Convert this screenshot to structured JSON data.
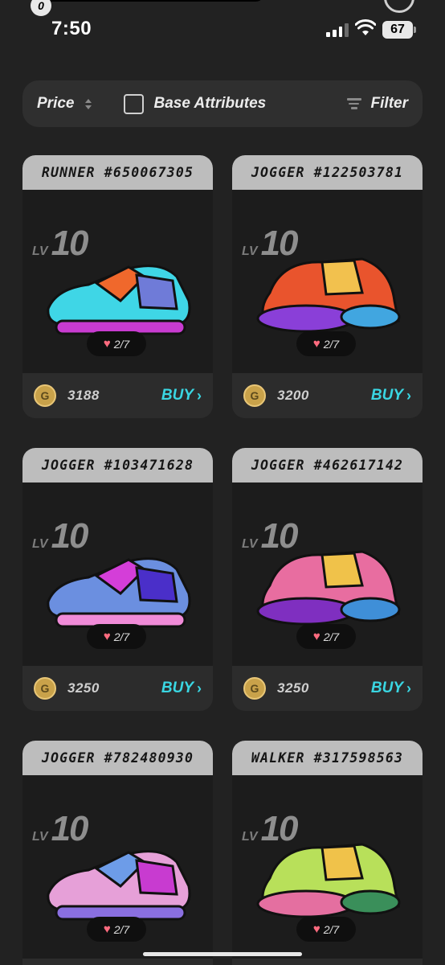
{
  "status": {
    "time": "7:50",
    "battery": "67",
    "badge": "0"
  },
  "toolbar": {
    "sort_label": "Price",
    "attr_label": "Base Attributes",
    "filter_label": "Filter"
  },
  "cards": [
    {
      "title": "RUNNER #650067305",
      "lv_label": "LV",
      "lv": "10",
      "hp": "2/7",
      "price": "3188",
      "buy": "BUY",
      "palette": [
        "#3fd6e6",
        "#f0682c",
        "#6f7bd8",
        "#c83bd0"
      ]
    },
    {
      "title": "JOGGER #122503781",
      "lv_label": "LV",
      "lv": "10",
      "hp": "2/7",
      "price": "3200",
      "buy": "BUY",
      "palette": [
        "#e9542d",
        "#8a3fd8",
        "#f2c14e",
        "#41a6e0"
      ]
    },
    {
      "title": "JOGGER #103471628",
      "lv_label": "LV",
      "lv": "10",
      "hp": "2/7",
      "price": "3250",
      "buy": "BUY",
      "palette": [
        "#6b8fe0",
        "#d43ed8",
        "#4a2fc9",
        "#f08bd8"
      ]
    },
    {
      "title": "JOGGER #462617142",
      "lv_label": "LV",
      "lv": "10",
      "hp": "2/7",
      "price": "3250",
      "buy": "BUY",
      "palette": [
        "#e86da0",
        "#7f2fc0",
        "#f0c24a",
        "#3f8fd8"
      ]
    },
    {
      "title": "JOGGER #782480930",
      "lv_label": "LV",
      "lv": "10",
      "hp": "2/7",
      "price": "",
      "buy": "",
      "palette": [
        "#e6a0d8",
        "#6d9ce8",
        "#c83bd0",
        "#8a6fe0"
      ]
    },
    {
      "title": "WALKER #317598563",
      "lv_label": "LV",
      "lv": "10",
      "hp": "2/7",
      "price": "",
      "buy": "",
      "palette": [
        "#b8e05a",
        "#e46fa0",
        "#f0c24a",
        "#3a8f5a"
      ]
    }
  ]
}
